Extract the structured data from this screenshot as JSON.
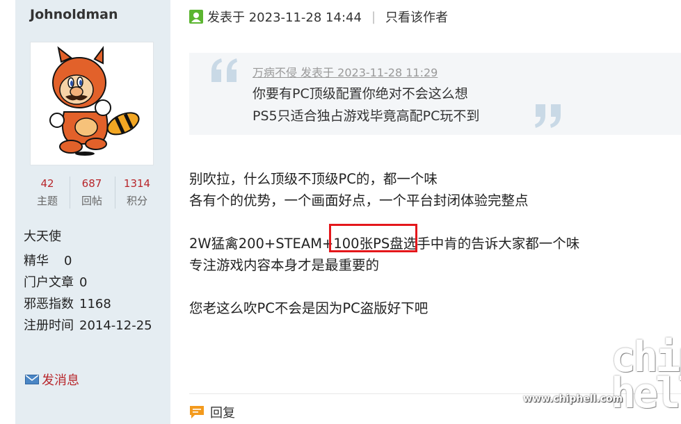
{
  "user": {
    "username": "Johnoldman",
    "stats": [
      {
        "value": "42",
        "label": "主题"
      },
      {
        "value": "687",
        "label": "回帖"
      },
      {
        "value": "1314",
        "label": "积分"
      }
    ],
    "group": "大天使",
    "info": [
      {
        "key": "精华",
        "value": "0"
      },
      {
        "key": "门户文章",
        "value": "0"
      },
      {
        "key": "邪恶指数",
        "value": "1168"
      },
      {
        "key": "注册时间",
        "value": "2014-12-25"
      }
    ],
    "send_message_label": "发消息"
  },
  "post": {
    "posted_at": "发表于 2023-11-28 14:44",
    "author_only": "只看该作者",
    "quote": {
      "meta": "万病不侵 发表于 2023-11-28 11:29",
      "lines": [
        "你要有PC顶级配置你绝对不会这么想",
        "PS5只适合独占游戏毕竟高配PC玩不到"
      ]
    },
    "lines": [
      "别吹拉，什么顶级不顶级PC的，都一个味",
      "各有个的优势，一个画面好点，一个平台封闭体验完整点",
      "2W猛禽200+STEAM+100张PS盘选手中肯的告诉大家都一个味",
      "专注游戏内容本身才是最重要的",
      "您老这么吹PC不会是因为PC盗版好下吧"
    ],
    "reply_label": "回复"
  },
  "watermark": {
    "logo_text": "chip hell",
    "url": "www.chiphell.com"
  },
  "colors": {
    "sidebar_bg": "#e5edf2",
    "accent_red": "#b8262b",
    "highlight": "#e4171b",
    "quote_bg": "#f4f6f8"
  }
}
